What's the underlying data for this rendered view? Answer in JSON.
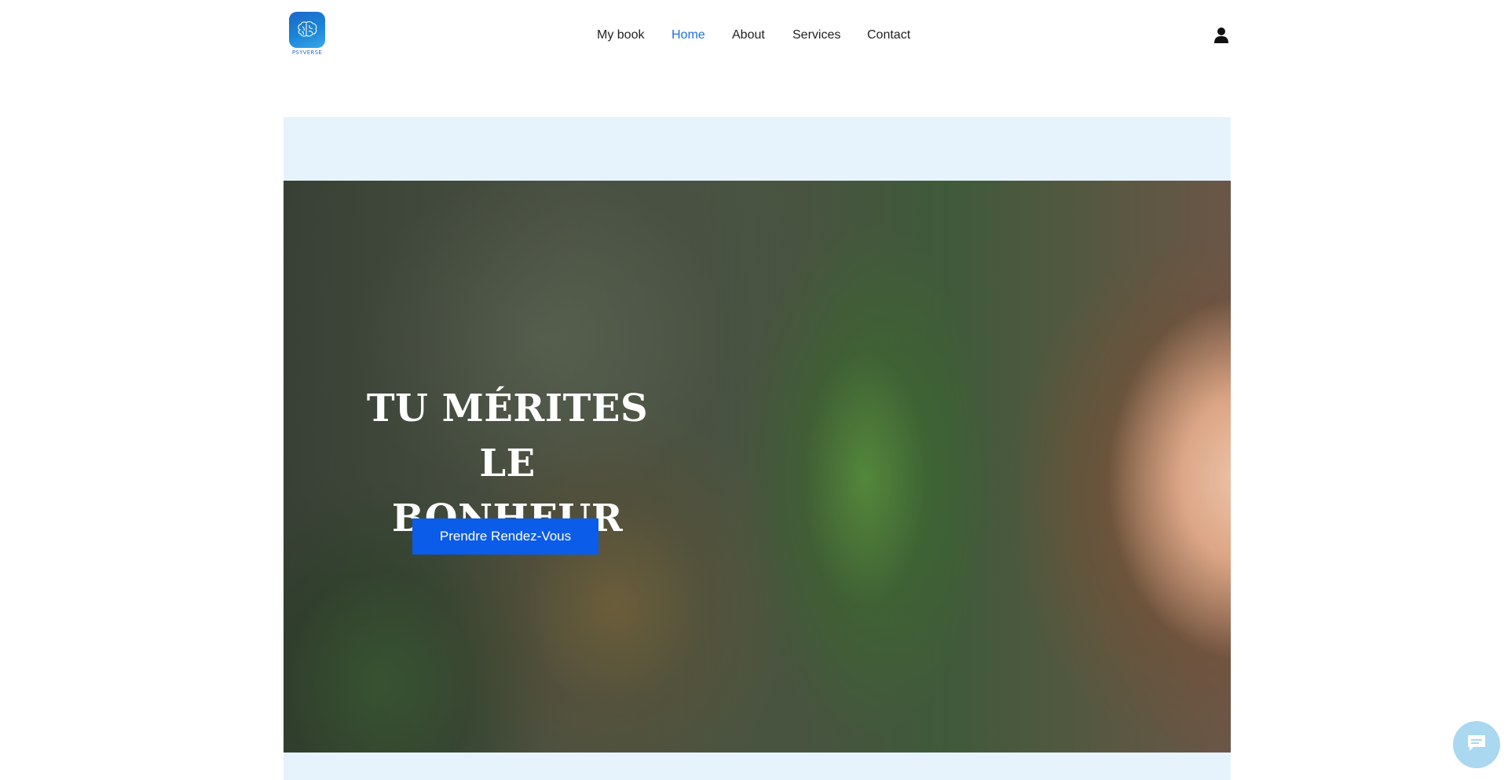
{
  "logo": {
    "icon": "brain-icon",
    "text": "PSYVERSE"
  },
  "nav": {
    "items": [
      {
        "label": "My book"
      },
      {
        "label": "Home"
      },
      {
        "label": "About"
      },
      {
        "label": "Services"
      },
      {
        "label": "Contact"
      }
    ],
    "active": "Home"
  },
  "header": {
    "user_icon": "user-icon"
  },
  "hero": {
    "title_line1": "TU MÉRITES LE",
    "title_line2": "BONHEUR",
    "cta_label": "Prendre Rendez-Vous",
    "image": "smiling-woman-photo"
  },
  "chat": {
    "icon": "chat-icon"
  },
  "colors": {
    "accent": "#1d6fe0",
    "cta": "#0b5ce8",
    "section_bg": "#e6f3fc",
    "chat_bubble": "#a9d8f0"
  }
}
